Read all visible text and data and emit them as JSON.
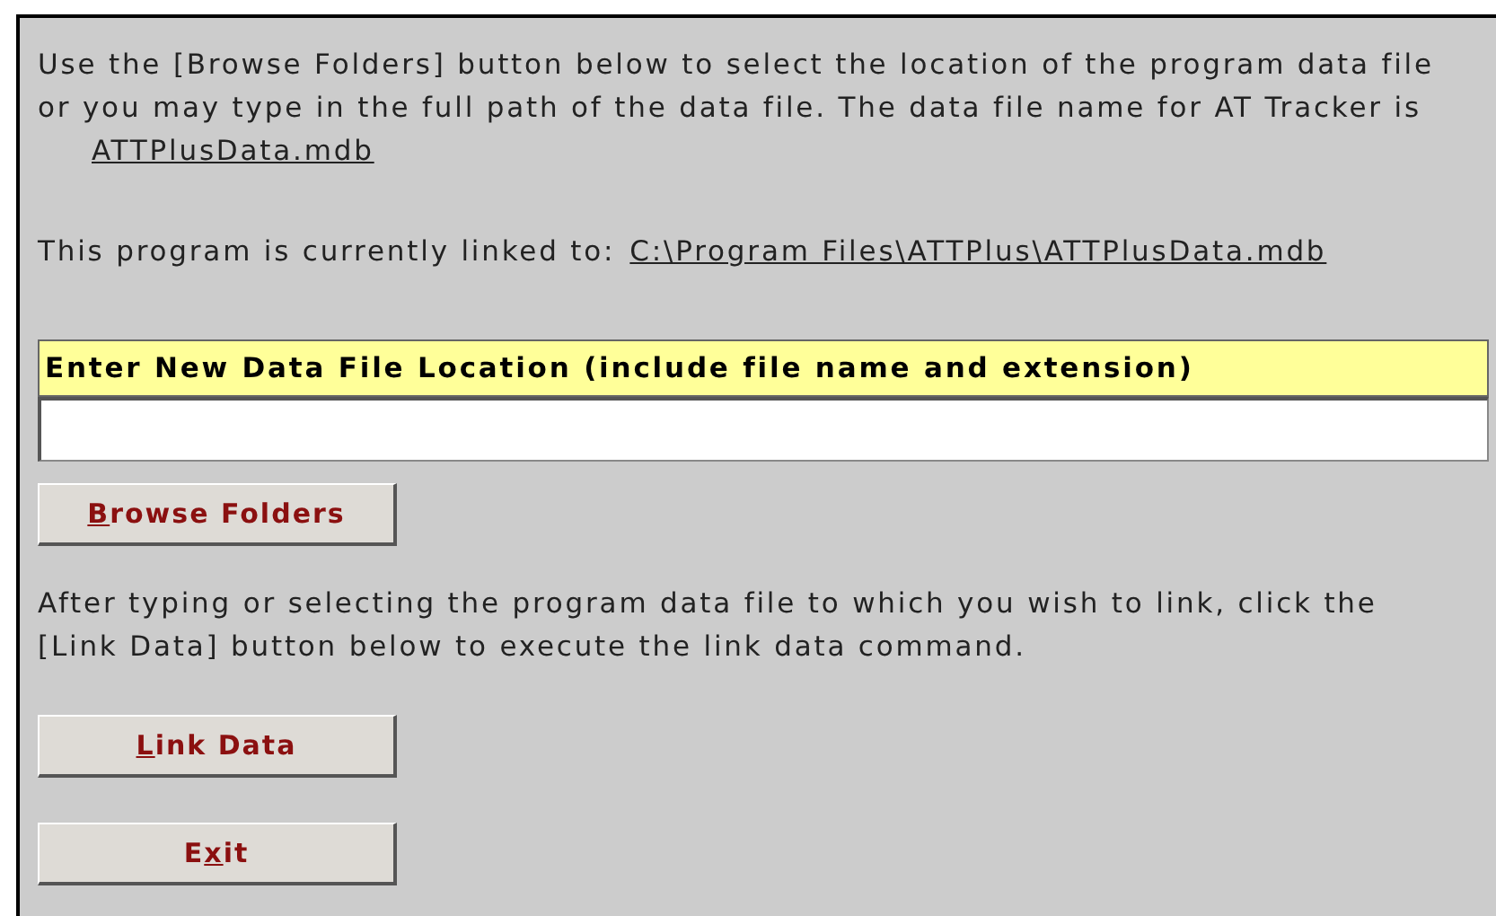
{
  "intro": {
    "lines": [
      "Use the [Browse Folders] button below to select the location of the program data file",
      "or you may type in the full path of the data file.  The data file name for AT Tracker is"
    ],
    "file_name": "ATTPlusData.mdb"
  },
  "current_link": {
    "label": "This program is currently linked to:",
    "path": "C:\\Program Files\\ATTPlus\\ATTPlusData.mdb"
  },
  "location_field": {
    "header": "Enter New Data File Location  (include file name and extension)"
  },
  "browse_button": {
    "access_key": "B",
    "after": "rowse Folders"
  },
  "instructions": {
    "lines": [
      "After typing or selecting the program data file to which you wish to link, click the",
      "[Link Data] button below to execute the link data command."
    ]
  },
  "buttons": [
    {
      "access_key": "L",
      "after": "ink Data"
    },
    {
      "before": "E",
      "access_key": "x",
      "after": "it"
    }
  ]
}
